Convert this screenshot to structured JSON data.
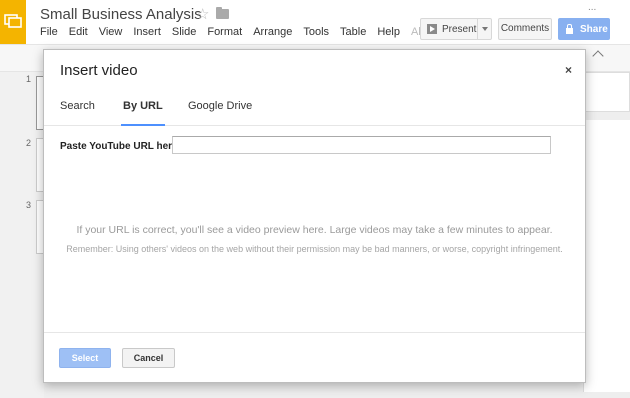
{
  "app": {
    "title": "Small Business Analysis",
    "menu": [
      "File",
      "Edit",
      "View",
      "Insert",
      "Slide",
      "Format",
      "Arrange",
      "Tools",
      "Table",
      "Help",
      "All c..."
    ],
    "present_label": "Present",
    "comments_label": "Comments",
    "share_label": "Share",
    "top_right_text": "..."
  },
  "filmstrip": {
    "slide_numbers": [
      "1",
      "2",
      "3"
    ]
  },
  "dialog": {
    "title": "Insert video",
    "close_glyph": "×",
    "tabs": [
      {
        "label": "Search",
        "active": false
      },
      {
        "label": "By URL",
        "active": true
      },
      {
        "label": "Google Drive",
        "active": false
      }
    ],
    "url_label": "Paste YouTube URL here:",
    "url_value": "",
    "preview_text": "If your URL is correct, you'll see a video preview here. Large videos may take a few minutes to appear.",
    "remember_text": "Remember: Using others' videos on the web without their permission may be bad manners, or worse, copyright infringement.",
    "select_label": "Select",
    "cancel_label": "Cancel"
  },
  "colors": {
    "accent": "#4d90fe",
    "share_button": "#88b0f0",
    "logo": "#f4b400"
  },
  "icons": [
    "slides-logo-icon",
    "star-icon",
    "folder-icon",
    "play-icon",
    "dropdown-caret-icon",
    "lock-icon",
    "collapse-chevron-icon",
    "close-icon"
  ]
}
